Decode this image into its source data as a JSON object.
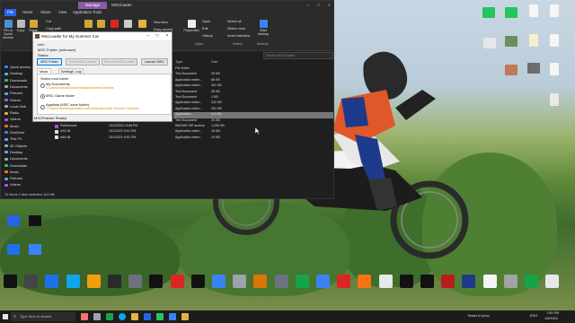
{
  "explorer": {
    "title": "MSCloader",
    "tabs": [
      "File",
      "Home",
      "Share",
      "View",
      "Application Tools"
    ],
    "manage_tab": "Manage",
    "ribbon": {
      "pin_label": "Pin to Quick access",
      "copy_label": "Copy",
      "paste_label": "Paste",
      "cut_label": "Cut",
      "copy_path_label": "Copy path",
      "paste_shortcut_label": "Paste shortcut",
      "new_item_label": "New item",
      "easy_access_label": "Easy access",
      "properties_label": "Properties",
      "open_label": "Open",
      "edit_label": "Edit",
      "history_label": "History",
      "select_all_label": "Select all",
      "select_none_label": "Select none",
      "invert_selection_label": "Invert selection",
      "start_backup_label": "Start backup",
      "group_open": "Open",
      "group_select": "Select",
      "group_backup": "Backup"
    },
    "search_placeholder": "Search MSCloader",
    "nav_items": [
      "Quick access",
      "Desktop",
      "Downloads",
      "Documents",
      "Pictures",
      "Videos",
      "Local Disk",
      "Radio",
      "Videos",
      "Music",
      "OneDrive",
      "This PC",
      "3D Objects",
      "Desktop",
      "Documents",
      "Downloads",
      "Music",
      "Pictures",
      "Videos"
    ],
    "columns": {
      "type": "Type",
      "size": "Size"
    },
    "rows": [
      {
        "name": "",
        "date": "",
        "type": "File folder",
        "size": ""
      },
      {
        "name": "",
        "date": "",
        "type": "Text Document",
        "size": "25 KB"
      },
      {
        "name": "",
        "date": "",
        "type": "Application exten...",
        "size": "66 KB"
      },
      {
        "name": "",
        "date": "",
        "type": "Application exten...",
        "size": "431 KB"
      },
      {
        "name": "",
        "date": "",
        "type": "Text Document",
        "size": "35 KB"
      },
      {
        "name": "",
        "date": "",
        "type": "Text Document",
        "size": "1 KB"
      },
      {
        "name": "",
        "date": "",
        "type": "Application exten...",
        "size": "332 KB"
      },
      {
        "name": "",
        "date": "",
        "type": "Application exten...",
        "size": "391 KB"
      },
      {
        "name": "",
        "date": "",
        "type": "Application",
        "size": "114 KB"
      },
      {
        "name": "",
        "date": "",
        "type": "Text Document",
        "size": "20 KB"
      },
      {
        "name": "References",
        "date": "10/13/2021 8:58 PM",
        "type": "WinRAR ZIP archive",
        "size": "1,038 KB"
      },
      {
        "name": "w32.dll",
        "date": "10/1/2021 9:51 PM",
        "type": "Application exten...",
        "size": "16 KB"
      },
      {
        "name": "w64.dll",
        "date": "10/1/2021 9:51 PM",
        "type": "Application exten...",
        "size": "19 KB"
      }
    ],
    "status_text": "12 items    1 item selected  113 KB"
  },
  "msc": {
    "title": "MscLoader for My Summer Car",
    "info_label": "Info:",
    "folder_label": "MSC Folder: (unknown)",
    "status_label": "Status:",
    "buttons": [
      "MSC Folder",
      "Install MSCLoader",
      "Remove MSCLoader",
      "Launch MSC"
    ],
    "tabs": [
      "Mods folder",
      "Settings",
      "Log"
    ],
    "select_label": "Select mod folder",
    "options": [
      {
        "label": "My Documents",
        "path": "C:\\Users\\Videos\\Documents\\MySummerCar\\Mods",
        "selected": false
      },
      {
        "label": "MSC Game folder",
        "path": "",
        "selected": true
      },
      {
        "label": "Appdata (MSC save folder)",
        "path": "C:\\Users\\Videos\\AppData\\LocalLow\\Amistech\\My Summer Car\\Mods",
        "selected": false
      }
    ],
    "footer_status": "MSCPatcher Ready!"
  },
  "desktop_bottom_icons": [
    "",
    "",
    "",
    "",
    "",
    "",
    "",
    "",
    "",
    "",
    "",
    "",
    "",
    "",
    "",
    "",
    "",
    "",
    "",
    "",
    "",
    "",
    "",
    "",
    "",
    "",
    ""
  ],
  "taskbar": {
    "search_placeholder": "Type here to search",
    "weather": "Temps to jump",
    "lang": "ENG",
    "time": "7:50 PM",
    "date": "1/6/2024"
  }
}
